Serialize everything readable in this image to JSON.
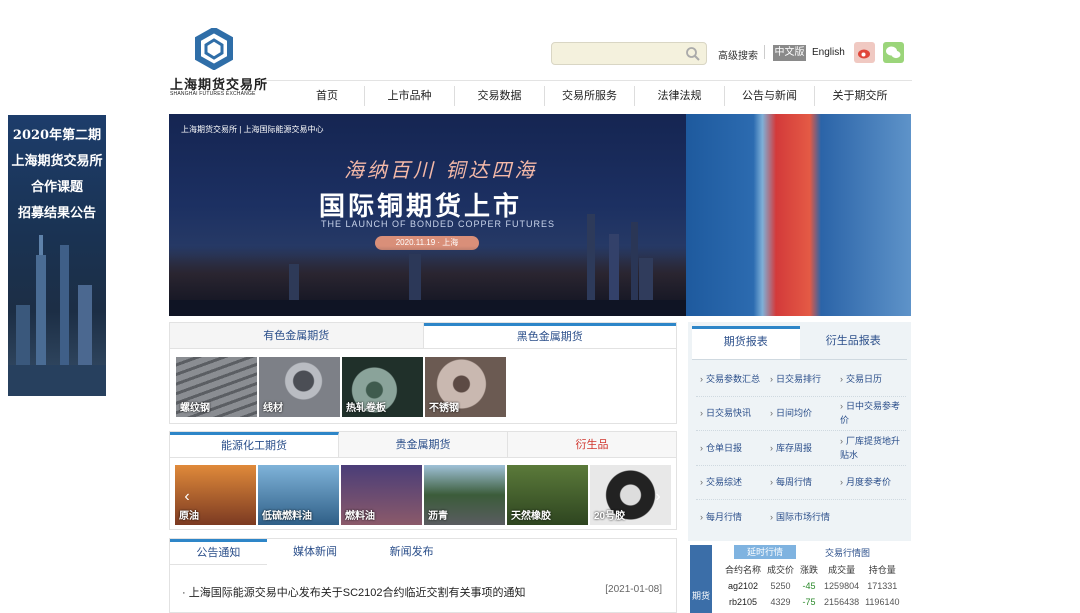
{
  "header": {
    "logo_cn": "上海期货交易所",
    "logo_en": "SHANGHAI FUTURES EXCHANGE",
    "search_placeholder": "",
    "advanced_search": "高级搜索",
    "lang_zh": "中文版",
    "lang_en": "English",
    "icons": [
      "search-icon",
      "weibo-icon",
      "wechat-icon"
    ]
  },
  "nav": [
    {
      "label": "首页"
    },
    {
      "label": "上市品种"
    },
    {
      "label": "交易数据"
    },
    {
      "label": "交易所服务"
    },
    {
      "label": "法律法规"
    },
    {
      "label": "公告与新闻"
    },
    {
      "label": "关于期交所"
    }
  ],
  "side_ad": {
    "lines": [
      "2020年第二期",
      "上海期货交易所",
      "合作课题",
      "招募结果公告"
    ]
  },
  "banner": {
    "logo_text": "上海期货交易所 | 上海国际能源交易中心",
    "slogan": "海纳百川 铜达四海",
    "title": "国际铜期货上市",
    "subtitle": "THE LAUNCH OF BONDED COPPER FUTURES",
    "date": "2020.11.19 · 上海"
  },
  "metals": {
    "tabs": [
      "有色金属期货",
      "黑色金属期货"
    ],
    "items": [
      "螺纹钢",
      "线材",
      "热轧卷板",
      "不锈钢"
    ]
  },
  "energy": {
    "tabs": [
      "能源化工期货",
      "贵金属期货",
      "衍生品"
    ],
    "items": [
      "原油",
      "低硫燃料油",
      "燃料油",
      "沥青",
      "天然橡胶",
      "20号胶"
    ]
  },
  "news": {
    "tabs": [
      "公告通知",
      "媒体新闻",
      "新闻发布"
    ],
    "items": [
      {
        "title": "上海国际能源交易中心发布关于SC2102合约临近交割有关事项的通知",
        "date": "[2021-01-08]"
      }
    ]
  },
  "reports": {
    "tabs": [
      "期货报表",
      "衍生品报表"
    ],
    "rows": [
      [
        "交易参数汇总",
        "日交易排行",
        "交易日历"
      ],
      [
        "日交易快讯",
        "日间均价",
        "日中交易参考价"
      ],
      [
        "仓单日报",
        "库存周报",
        "厂库提货地升贴水"
      ],
      [
        "交易综述",
        "每周行情",
        "月度参考价"
      ],
      [
        "每月行情",
        "国际市场行情",
        ""
      ]
    ]
  },
  "market": {
    "side_tab": "期货",
    "tab_delayed": "延时行情",
    "tab_chart": "交易行情图",
    "columns": [
      "合约名称",
      "成交价",
      "涨跌",
      "成交量",
      "持仓量"
    ],
    "rows": [
      [
        "ag2102",
        "5250",
        "-45",
        "1259804",
        "171331"
      ],
      [
        "rb2105",
        "4329",
        "-75",
        "2156438",
        "1196140"
      ]
    ]
  }
}
